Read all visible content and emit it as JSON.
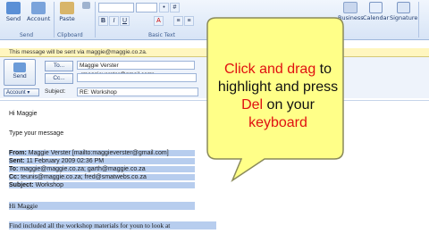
{
  "ribbon": {
    "send_label": "Send",
    "account_label": "Account",
    "paste_label": "Paste",
    "group_send": "Send",
    "group_clipboard": "Clipboard",
    "group_basic_text": "Basic Text",
    "business_label": "Business",
    "calendar_label": "Calendar",
    "signature_label": "Signature",
    "font_size_arrow": "-",
    "bold": "B",
    "italic": "I",
    "underline": "U",
    "font_color": "A"
  },
  "infobar": "This message will be sent via maggie@maggie.co.za.",
  "header": {
    "send_button": "Send",
    "to_button": "To...",
    "cc_button": "Cc...",
    "to_value": "Maggie Verster <maggieverster@gmail.com>",
    "cc_value": "",
    "account_button": "Account",
    "subject_label": "Subject:",
    "subject_value": "RE: Workshop"
  },
  "body": {
    "greeting": "Hi Maggie",
    "placeholder": "Type your message",
    "from_label": "From:",
    "from_value": "Maggie Verster [mailto:maggieverster@gmail.com]",
    "sent_label": "Sent:",
    "sent_value": "11 February 2009 02:36 PM",
    "to_label": "To:",
    "to_value": "maggie@maggie.co.za; garth@maggie.co.za",
    "cc_label": "Cc:",
    "cc_value": "teunis@maggie.co.za; fred@smatwebs.co.za",
    "subject_label": "Subject:",
    "subject_value": "Workshop",
    "quoted_greeting": "Hi Maggie",
    "quoted_line": "Find included all the workshop materials for youn to look at"
  },
  "callout": {
    "part1": "Click and drag",
    "part2": " to highlight and press ",
    "part3": "Del",
    "part4": " on your ",
    "part5": "keyboard"
  },
  "colors": {
    "highlight": "#b7cdee",
    "callout_fill": "#ffff88",
    "callout_red": "#e01010"
  }
}
